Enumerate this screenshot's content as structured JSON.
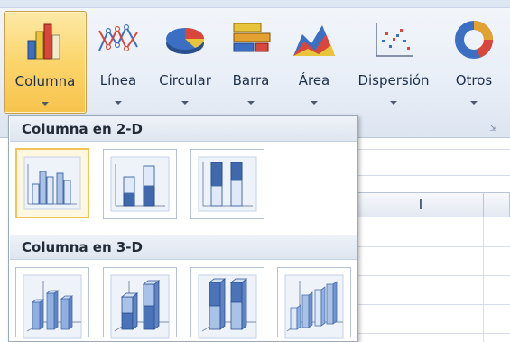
{
  "ribbon": {
    "buttons": [
      {
        "label": "Columna",
        "icon": "column-chart-icon",
        "active": true
      },
      {
        "label": "Línea",
        "icon": "line-chart-icon"
      },
      {
        "label": "Circular",
        "icon": "pie-chart-icon"
      },
      {
        "label": "Barra",
        "icon": "bar-chart-icon"
      },
      {
        "label": "Área",
        "icon": "area-chart-icon"
      },
      {
        "label": "Dispersión",
        "icon": "scatter-chart-icon"
      },
      {
        "label": "Otros",
        "icon": "other-charts-icon"
      }
    ]
  },
  "sheet": {
    "column_header": "I"
  },
  "dropdown": {
    "section_2d": "Columna en 2-D",
    "section_3d": "Columna en 3-D",
    "items_2d": [
      "clustered-column-icon",
      "stacked-column-icon",
      "100-stacked-column-icon"
    ],
    "items_3d": [
      "3d-clustered-column-icon",
      "3d-stacked-column-icon",
      "3d-100-stacked-column-icon",
      "3d-column-icon"
    ]
  }
}
